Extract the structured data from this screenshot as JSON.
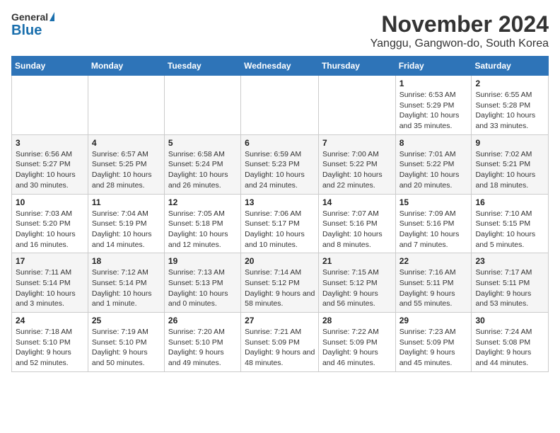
{
  "header": {
    "logo_general": "General",
    "logo_blue": "Blue",
    "title": "November 2024",
    "subtitle": "Yanggu, Gangwon-do, South Korea"
  },
  "weekdays": [
    "Sunday",
    "Monday",
    "Tuesday",
    "Wednesday",
    "Thursday",
    "Friday",
    "Saturday"
  ],
  "weeks": [
    [
      {
        "day": "",
        "info": ""
      },
      {
        "day": "",
        "info": ""
      },
      {
        "day": "",
        "info": ""
      },
      {
        "day": "",
        "info": ""
      },
      {
        "day": "",
        "info": ""
      },
      {
        "day": "1",
        "info": "Sunrise: 6:53 AM\nSunset: 5:29 PM\nDaylight: 10 hours and 35 minutes."
      },
      {
        "day": "2",
        "info": "Sunrise: 6:55 AM\nSunset: 5:28 PM\nDaylight: 10 hours and 33 minutes."
      }
    ],
    [
      {
        "day": "3",
        "info": "Sunrise: 6:56 AM\nSunset: 5:27 PM\nDaylight: 10 hours and 30 minutes."
      },
      {
        "day": "4",
        "info": "Sunrise: 6:57 AM\nSunset: 5:25 PM\nDaylight: 10 hours and 28 minutes."
      },
      {
        "day": "5",
        "info": "Sunrise: 6:58 AM\nSunset: 5:24 PM\nDaylight: 10 hours and 26 minutes."
      },
      {
        "day": "6",
        "info": "Sunrise: 6:59 AM\nSunset: 5:23 PM\nDaylight: 10 hours and 24 minutes."
      },
      {
        "day": "7",
        "info": "Sunrise: 7:00 AM\nSunset: 5:22 PM\nDaylight: 10 hours and 22 minutes."
      },
      {
        "day": "8",
        "info": "Sunrise: 7:01 AM\nSunset: 5:22 PM\nDaylight: 10 hours and 20 minutes."
      },
      {
        "day": "9",
        "info": "Sunrise: 7:02 AM\nSunset: 5:21 PM\nDaylight: 10 hours and 18 minutes."
      }
    ],
    [
      {
        "day": "10",
        "info": "Sunrise: 7:03 AM\nSunset: 5:20 PM\nDaylight: 10 hours and 16 minutes."
      },
      {
        "day": "11",
        "info": "Sunrise: 7:04 AM\nSunset: 5:19 PM\nDaylight: 10 hours and 14 minutes."
      },
      {
        "day": "12",
        "info": "Sunrise: 7:05 AM\nSunset: 5:18 PM\nDaylight: 10 hours and 12 minutes."
      },
      {
        "day": "13",
        "info": "Sunrise: 7:06 AM\nSunset: 5:17 PM\nDaylight: 10 hours and 10 minutes."
      },
      {
        "day": "14",
        "info": "Sunrise: 7:07 AM\nSunset: 5:16 PM\nDaylight: 10 hours and 8 minutes."
      },
      {
        "day": "15",
        "info": "Sunrise: 7:09 AM\nSunset: 5:16 PM\nDaylight: 10 hours and 7 minutes."
      },
      {
        "day": "16",
        "info": "Sunrise: 7:10 AM\nSunset: 5:15 PM\nDaylight: 10 hours and 5 minutes."
      }
    ],
    [
      {
        "day": "17",
        "info": "Sunrise: 7:11 AM\nSunset: 5:14 PM\nDaylight: 10 hours and 3 minutes."
      },
      {
        "day": "18",
        "info": "Sunrise: 7:12 AM\nSunset: 5:14 PM\nDaylight: 10 hours and 1 minute."
      },
      {
        "day": "19",
        "info": "Sunrise: 7:13 AM\nSunset: 5:13 PM\nDaylight: 10 hours and 0 minutes."
      },
      {
        "day": "20",
        "info": "Sunrise: 7:14 AM\nSunset: 5:12 PM\nDaylight: 9 hours and 58 minutes."
      },
      {
        "day": "21",
        "info": "Sunrise: 7:15 AM\nSunset: 5:12 PM\nDaylight: 9 hours and 56 minutes."
      },
      {
        "day": "22",
        "info": "Sunrise: 7:16 AM\nSunset: 5:11 PM\nDaylight: 9 hours and 55 minutes."
      },
      {
        "day": "23",
        "info": "Sunrise: 7:17 AM\nSunset: 5:11 PM\nDaylight: 9 hours and 53 minutes."
      }
    ],
    [
      {
        "day": "24",
        "info": "Sunrise: 7:18 AM\nSunset: 5:10 PM\nDaylight: 9 hours and 52 minutes."
      },
      {
        "day": "25",
        "info": "Sunrise: 7:19 AM\nSunset: 5:10 PM\nDaylight: 9 hours and 50 minutes."
      },
      {
        "day": "26",
        "info": "Sunrise: 7:20 AM\nSunset: 5:10 PM\nDaylight: 9 hours and 49 minutes."
      },
      {
        "day": "27",
        "info": "Sunrise: 7:21 AM\nSunset: 5:09 PM\nDaylight: 9 hours and 48 minutes."
      },
      {
        "day": "28",
        "info": "Sunrise: 7:22 AM\nSunset: 5:09 PM\nDaylight: 9 hours and 46 minutes."
      },
      {
        "day": "29",
        "info": "Sunrise: 7:23 AM\nSunset: 5:09 PM\nDaylight: 9 hours and 45 minutes."
      },
      {
        "day": "30",
        "info": "Sunrise: 7:24 AM\nSunset: 5:08 PM\nDaylight: 9 hours and 44 minutes."
      }
    ]
  ]
}
